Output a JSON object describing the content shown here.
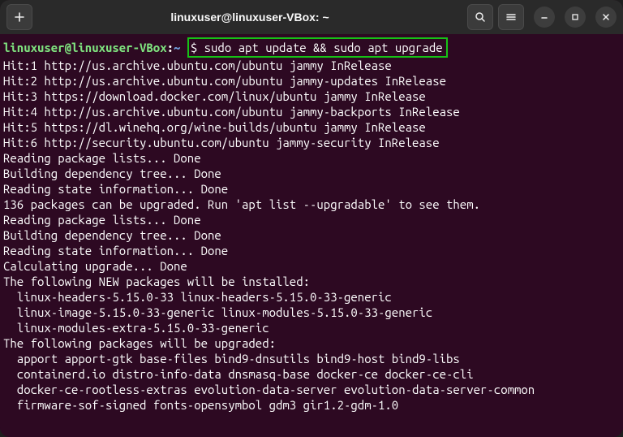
{
  "titlebar": {
    "title": "linuxuser@linuxuser-VBox: ~"
  },
  "prompt": {
    "user_host": "linuxuser@linuxuser-VBox",
    "sep": ":",
    "cwd": "~",
    "command": "$ sudo apt update && sudo apt upgrade"
  },
  "output": [
    "Hit:1 http://us.archive.ubuntu.com/ubuntu jammy InRelease",
    "Hit:2 http://us.archive.ubuntu.com/ubuntu jammy-updates InRelease",
    "Hit:3 https://download.docker.com/linux/ubuntu jammy InRelease",
    "Hit:4 http://us.archive.ubuntu.com/ubuntu jammy-backports InRelease",
    "Hit:5 https://dl.winehq.org/wine-builds/ubuntu jammy InRelease",
    "Hit:6 http://security.ubuntu.com/ubuntu jammy-security InRelease",
    "Reading package lists... Done",
    "Building dependency tree... Done",
    "Reading state information... Done",
    "136 packages can be upgraded. Run 'apt list --upgradable' to see them.",
    "Reading package lists... Done",
    "Building dependency tree... Done",
    "Reading state information... Done",
    "Calculating upgrade... Done",
    "The following NEW packages will be installed:",
    "  linux-headers-5.15.0-33 linux-headers-5.15.0-33-generic",
    "  linux-image-5.15.0-33-generic linux-modules-5.15.0-33-generic",
    "  linux-modules-extra-5.15.0-33-generic",
    "The following packages will be upgraded:",
    "  apport apport-gtk base-files bind9-dnsutils bind9-host bind9-libs",
    "  containerd.io distro-info-data dnsmasq-base docker-ce docker-ce-cli",
    "  docker-ce-rootless-extras evolution-data-server evolution-data-server-common",
    "  firmware-sof-signed fonts-opensymbol gdm3 gir1.2-gdm-1.0"
  ]
}
